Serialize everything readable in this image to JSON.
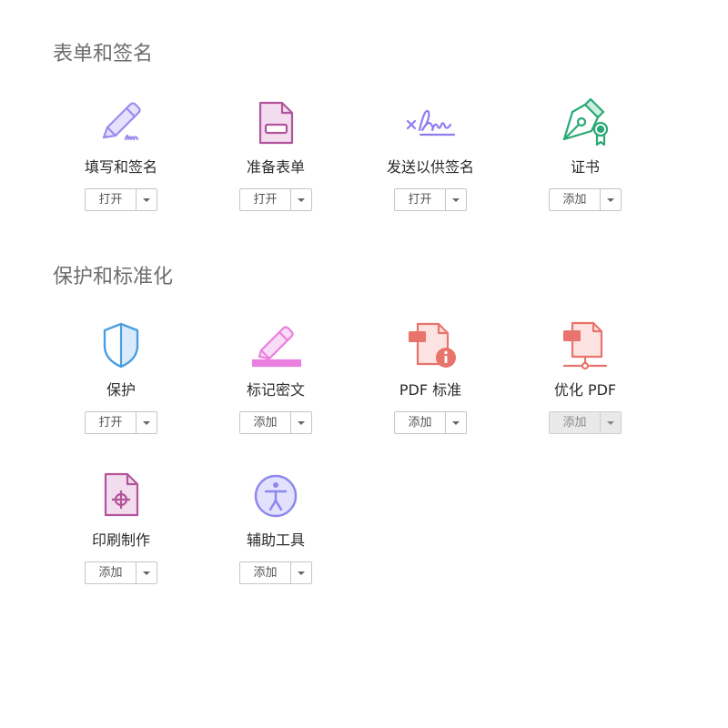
{
  "sections": [
    {
      "title": "表单和签名",
      "tools": [
        {
          "label": "填写和签名",
          "button": "打开",
          "icon": "fill-sign-icon"
        },
        {
          "label": "准备表单",
          "button": "打开",
          "icon": "prepare-form-icon"
        },
        {
          "label": "发送以供签名",
          "button": "打开",
          "icon": "send-signature-icon"
        },
        {
          "label": "证书",
          "button": "添加",
          "icon": "certificate-icon"
        }
      ]
    },
    {
      "title": "保护和标准化",
      "tools": [
        {
          "label": "保护",
          "button": "打开",
          "icon": "shield-icon"
        },
        {
          "label": "标记密文",
          "button": "添加",
          "icon": "redact-icon"
        },
        {
          "label": "PDF 标准",
          "button": "添加",
          "icon": "pdf-standards-icon"
        },
        {
          "label": "优化 PDF",
          "button": "添加",
          "icon": "optimize-pdf-icon",
          "disabled": true
        },
        {
          "label": "印刷制作",
          "button": "添加",
          "icon": "print-production-icon"
        },
        {
          "label": "辅助工具",
          "button": "添加",
          "icon": "accessibility-icon"
        }
      ]
    }
  ],
  "colors": {
    "purple": "#9b8cf0",
    "magenta": "#b2549c",
    "green": "#2aa876",
    "blue": "#4a9ee0",
    "pink": "#ea7fe0",
    "red": "#e8746c"
  }
}
